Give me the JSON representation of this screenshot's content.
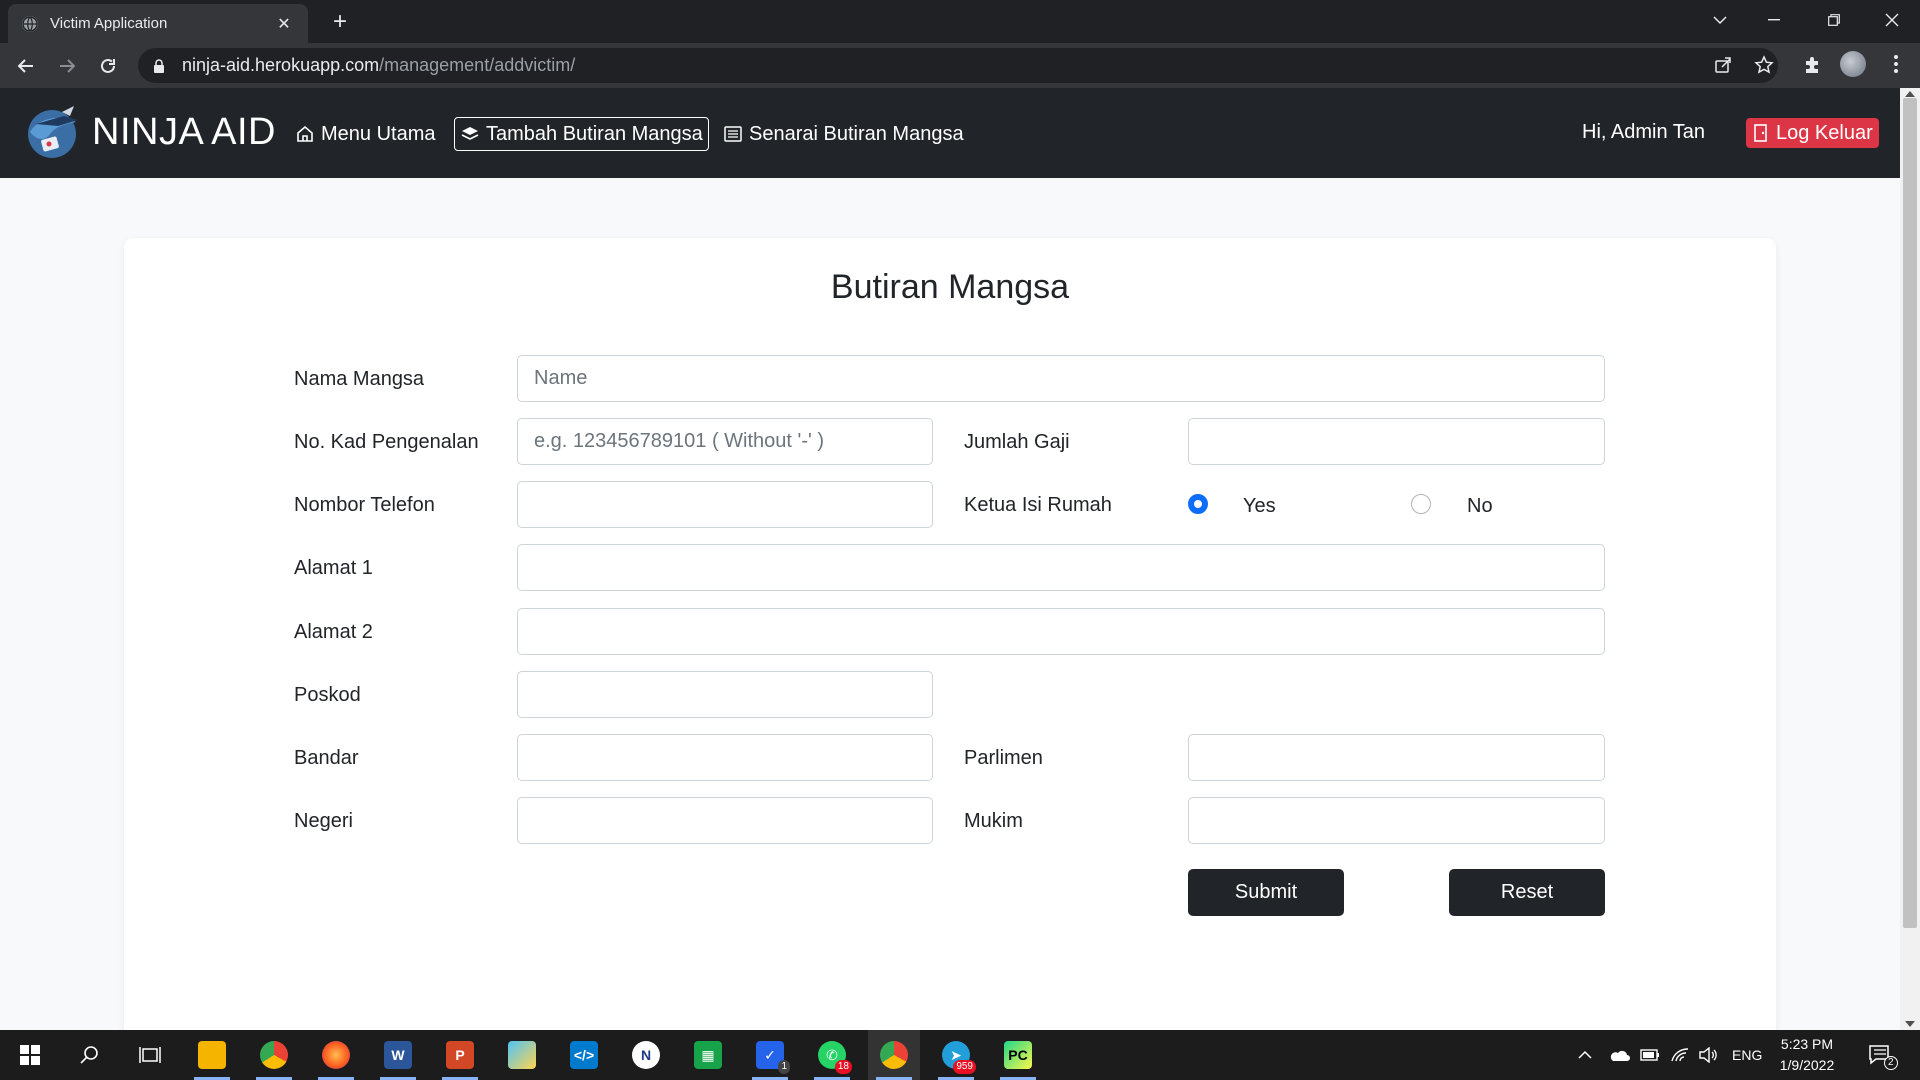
{
  "browser": {
    "tab_title": "Victim Application",
    "tab_close": "✕",
    "new_tab": "+",
    "url_host": "ninja-aid.herokuapp.com",
    "url_path": "/management/addvictim/"
  },
  "app": {
    "brand": "NINJA AID",
    "nav": {
      "home": "Menu Utama",
      "add_victim": "Tambah Butiran Mangsa",
      "victim_list": "Senarai Butiran Mangsa"
    },
    "greeting": "Hi, Admin Tan",
    "logout": "Log Keluar"
  },
  "form": {
    "title": "Butiran Mangsa",
    "labels": {
      "name": "Nama Mangsa",
      "ic": "No. Kad Pengenalan",
      "salary": "Jumlah Gaji",
      "phone": "Nombor Telefon",
      "head": "Ketua Isi Rumah",
      "addr1": "Alamat 1",
      "addr2": "Alamat 2",
      "postcode": "Poskod",
      "city": "Bandar",
      "parliament": "Parlimen",
      "state": "Negeri",
      "mukim": "Mukim"
    },
    "placeholders": {
      "name": "Name",
      "ic": "e.g. 123456789101 ( Without '-' )"
    },
    "radio": {
      "yes": "Yes",
      "no": "No",
      "selected": "Yes"
    },
    "buttons": {
      "submit": "Submit",
      "reset": "Reset"
    }
  },
  "taskbar": {
    "whatsapp_badge": "18",
    "telegram_badge": "959",
    "todo_badge": "1",
    "language": "ENG",
    "time": "5:23 PM",
    "date": "1/9/2022",
    "notifications": "2"
  },
  "colors": {
    "navbar": "#212529",
    "logout": "#dc3545",
    "radio_accent": "#0d6efd",
    "browser_dark": "#202124"
  }
}
